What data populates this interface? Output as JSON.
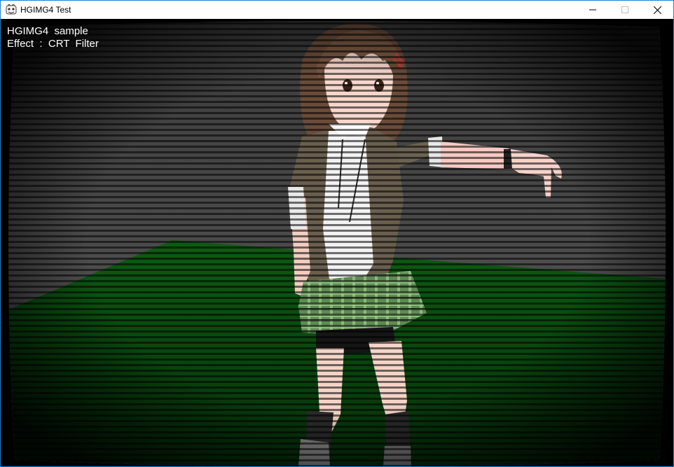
{
  "window": {
    "title": "HGIMG4 Test",
    "icon": "app-icon",
    "controls": {
      "minimize": "minimize-icon",
      "maximize": "maximize-icon",
      "close": "close-icon"
    }
  },
  "overlay": {
    "line1": "HGIMG4  sample",
    "line2": "Effect  :  CRT  Filter"
  },
  "scene": {
    "effect": "CRT scanline filter",
    "floor_color": "#0f5a14",
    "wall_color": "#4a4a4a"
  }
}
